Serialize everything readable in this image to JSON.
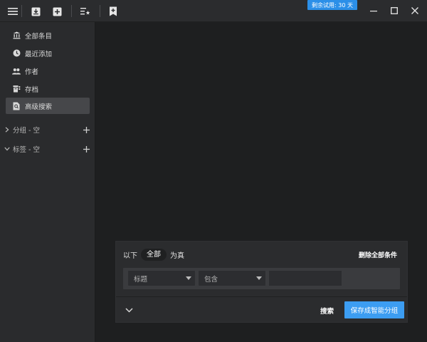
{
  "titlebar": {
    "trial_badge": "剩余试用: 30 天",
    "icons": [
      "menu-icon",
      "import-icon",
      "add-icon",
      "list-star-icon",
      "bookmark-plus-icon"
    ],
    "window_controls": [
      "minimize-icon",
      "maximize-icon",
      "close-icon"
    ]
  },
  "sidebar": {
    "items": [
      {
        "label": "全部条目",
        "icon": "bank-icon"
      },
      {
        "label": "最近添加",
        "icon": "clock-icon"
      },
      {
        "label": "作者",
        "icon": "people-icon"
      },
      {
        "label": "存档",
        "icon": "archive-icon"
      },
      {
        "label": "高级搜索",
        "icon": "search-file-icon",
        "active": true
      }
    ],
    "groups": [
      {
        "label": "分组 - 空",
        "chevron": "chevron-right-icon"
      },
      {
        "label": "标签 - 空",
        "chevron": "chevron-down-icon"
      }
    ]
  },
  "search_panel": {
    "prefix": "以下",
    "scope_value": "全部",
    "suffix": "为真",
    "delete_all_label": "删除全部条件",
    "condition": {
      "field_value": "标题",
      "operator_value": "包含",
      "value": ""
    },
    "search_label": "搜索",
    "save_label": "保存成智能分组"
  },
  "colors": {
    "accent": "#3c9df2",
    "badge": "#2b8fe8",
    "sidebar_bg": "#2a2b2d",
    "main_bg": "#1e1f20"
  }
}
